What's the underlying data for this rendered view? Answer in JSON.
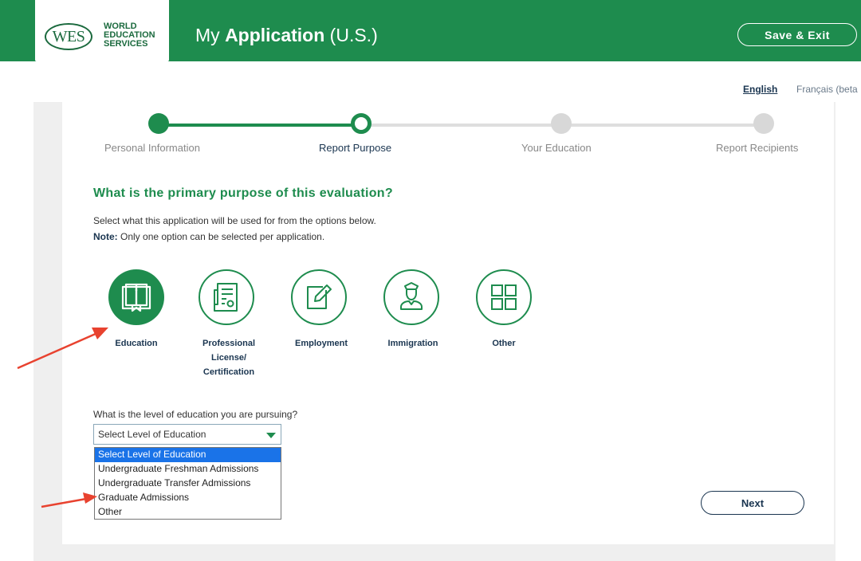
{
  "header": {
    "logo_mark": "WES",
    "logo_lines": [
      "WORLD",
      "EDUCATION",
      "SERVICES"
    ],
    "title_prefix": "My ",
    "title_bold": "Application",
    "title_suffix": " (U.S.)",
    "save_exit_label": "Save & Exit",
    "background_color": "#1e8c4e"
  },
  "language": {
    "english": "English",
    "french": "Français (beta"
  },
  "stepper": {
    "steps": [
      {
        "label": "Personal Information",
        "state": "completed"
      },
      {
        "label": "Report Purpose",
        "state": "current"
      },
      {
        "label": "Your Education",
        "state": "upcoming"
      },
      {
        "label": "Report Recipients",
        "state": "upcoming"
      }
    ]
  },
  "main": {
    "question": "What is the primary purpose of this evaluation?",
    "instruction": "Select what this application will be used for from the options below.",
    "note_label": "Note:",
    "note_text": " Only one option can be selected per application.",
    "options": [
      {
        "label": "Education",
        "icon": "book-icon",
        "selected": true
      },
      {
        "label_lines": [
          "Professional",
          "License/",
          "Certification"
        ],
        "icon": "certificate-icon",
        "selected": false
      },
      {
        "label": "Employment",
        "icon": "edit-document-icon",
        "selected": false
      },
      {
        "label": "Immigration",
        "icon": "officer-icon",
        "selected": false
      },
      {
        "label": "Other",
        "icon": "grid-icon",
        "selected": false
      }
    ]
  },
  "level": {
    "question": "What is the level of education you are pursuing?",
    "selected": "Select Level of Education",
    "options": [
      "Select Level of Education",
      "Undergraduate Freshman Admissions",
      "Undergraduate Transfer Admissions",
      "Graduate Admissions",
      "Other"
    ]
  },
  "next_label": "Next",
  "colors": {
    "accent": "#1e8c4e",
    "navy": "#1a3550",
    "annotation_arrow": "#e8422f"
  }
}
